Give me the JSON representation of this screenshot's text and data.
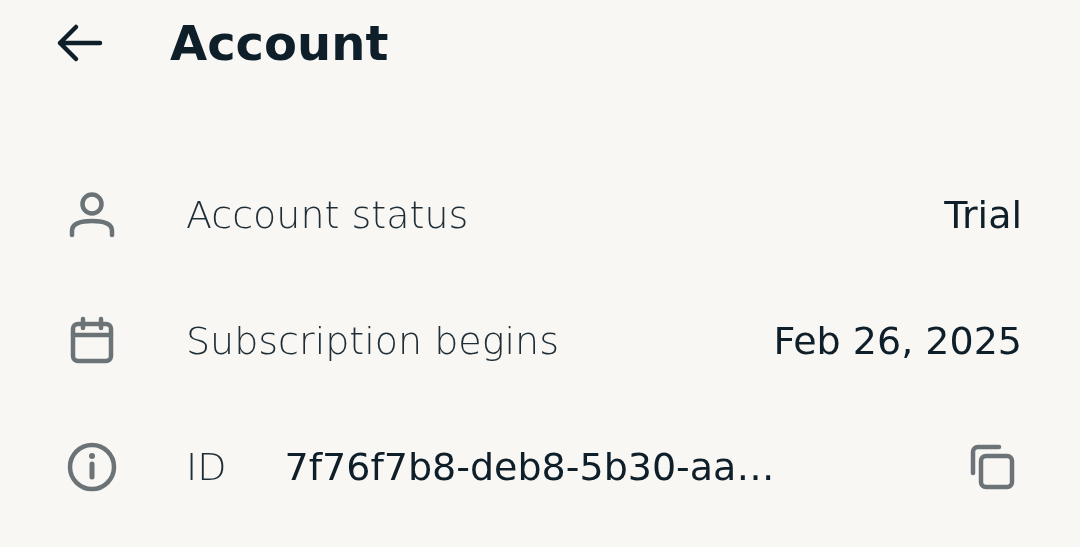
{
  "header": {
    "title": "Account"
  },
  "rows": [
    {
      "kind": "person",
      "label": "Account status",
      "value": "Trial"
    },
    {
      "kind": "calendar",
      "label": "Subscription begins",
      "value": "Feb 26, 2025"
    },
    {
      "kind": "id",
      "label": "ID",
      "value": "7f76f7b8-deb8-5b30-aa…"
    }
  ]
}
